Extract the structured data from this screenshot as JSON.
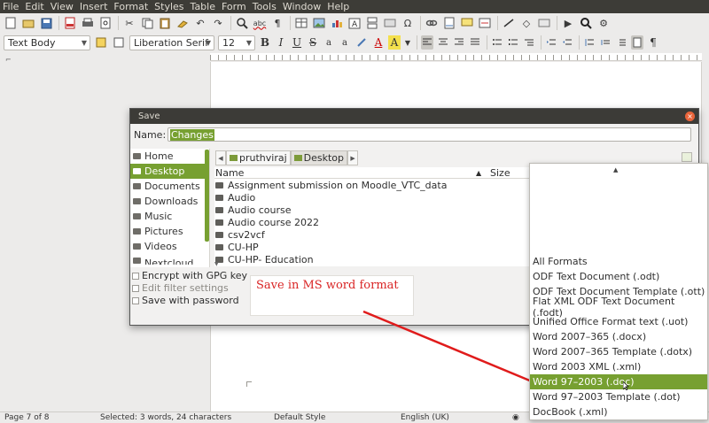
{
  "menu": [
    "File",
    "Edit",
    "View",
    "Insert",
    "Format",
    "Styles",
    "Table",
    "Form",
    "Tools",
    "Window",
    "Help"
  ],
  "toolbar": {
    "icons": [
      "new-icon",
      "open-icon",
      "save-icon",
      "export-pdf-icon",
      "print-icon",
      "print-preview-icon",
      "cut-icon",
      "copy-icon",
      "paste-icon",
      "clone-icon",
      "undo-icon",
      "redo-icon",
      "find-replace-icon",
      "spelling-icon",
      "formatting-marks-icon",
      "table-icon",
      "image-icon",
      "chart-icon",
      "text-box-icon",
      "page-break-icon",
      "field-icon",
      "special-character-icon",
      "hyperlink-icon",
      "footnote-icon",
      "comment-icon",
      "track-changes-icon",
      "line-icon",
      "shapes-icon",
      "draw-icon",
      "macro-icon",
      "zoom-icon",
      "settings-icon"
    ],
    "abc_label": "abc",
    "pilcrow": "¶",
    "omega": "Ω"
  },
  "format_bar": {
    "paragraph_style": "Text Body",
    "font_name": "Liberation Serif",
    "font_size": "12",
    "bold": "B",
    "italic": "I",
    "underline": "U",
    "strikethrough": "S",
    "superscript": "a",
    "subscript": "a",
    "font_color": "A",
    "highlight": "A",
    "pilcrow": "¶"
  },
  "status": {
    "page": "Page 7 of 8",
    "selection": "Selected: 3 words, 24 characters",
    "page_style": "Default Style",
    "language": "English (UK)"
  },
  "dialog": {
    "title": "Save",
    "name_label": "Name:",
    "name_value": "Changes",
    "places": [
      "Home",
      "Desktop",
      "Documents",
      "Downloads",
      "Music",
      "Pictures",
      "Videos",
      "Nextcloud"
    ],
    "selected_place": "Desktop",
    "path": [
      "pruthviraj",
      "Desktop"
    ],
    "col_name": "Name",
    "col_size": "Size",
    "sort_arrow": "▲",
    "files": [
      "Assignment submission on Moodle_VTC_data",
      "Audio",
      "Audio course",
      "Audio course 2022",
      "csv2vcf",
      "CU-HP",
      "CU-HP- Education"
    ],
    "options": {
      "encrypt": "Encrypt with GPG key",
      "edit_filter": "Edit filter settings",
      "save_password": "Save with password"
    }
  },
  "annotation": {
    "text": "Save in MS word format",
    "color": "#d92525"
  },
  "formats": {
    "items": [
      "All Formats",
      "ODF Text Document (.odt)",
      "ODF Text Document Template (.ott)",
      "Flat XML ODF Text Document (.fodt)",
      "Unified Office Format text (.uot)",
      "Word 2007–365 (.docx)",
      "Word 2007–365 Template (.dotx)",
      "Word 2003 XML (.xml)",
      "Word 97–2003 (.doc)",
      "Word 97–2003 Template (.dot)",
      "DocBook (.xml)"
    ],
    "selected": "Word 97–2003 (.doc)"
  },
  "colors": {
    "accent": "#77a031",
    "titlebar": "#3c3b37",
    "close": "#e9643a"
  }
}
